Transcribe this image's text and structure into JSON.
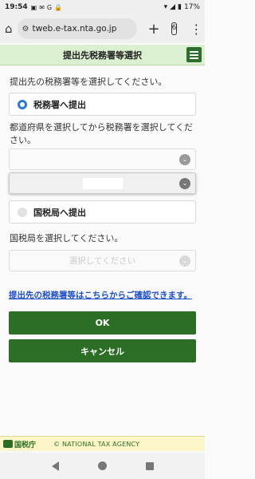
{
  "status": {
    "time": "19:54",
    "battery": "17%",
    "icons": [
      "notif-icon",
      "gmail-icon",
      "google-icon",
      "lock-icon",
      "wifi-icon",
      "signal-icon",
      "battery-icon"
    ]
  },
  "browser": {
    "url": "tweb.e-tax.nta.go.jp",
    "tab_count": "6"
  },
  "header": {
    "title": "提出先税務署等選択"
  },
  "form": {
    "intro": "提出先の税務署等を選択してください。",
    "option_tax_office": "税務署へ提出",
    "prefecture_instruction": "都道府県を選択してから税務署を選択してください。",
    "option_regional_bureau": "国税局へ提出",
    "bureau_instruction": "国税局を選択してください。",
    "bureau_select_placeholder": "選択してください",
    "confirm_link": "提出先の税務署等はこちらからご確認できます。"
  },
  "buttons": {
    "ok": "OK",
    "cancel": "キャンセル"
  },
  "footer": {
    "logo_text": "国税庁",
    "copyright": "© NATIONAL TAX AGENCY"
  },
  "colors": {
    "header_bg": "#dbefd1",
    "primary_green": "#2c6e26",
    "link_blue": "#1f4fc7",
    "radio_blue": "#2d79d1",
    "footer_bg": "#fcf6c9"
  }
}
